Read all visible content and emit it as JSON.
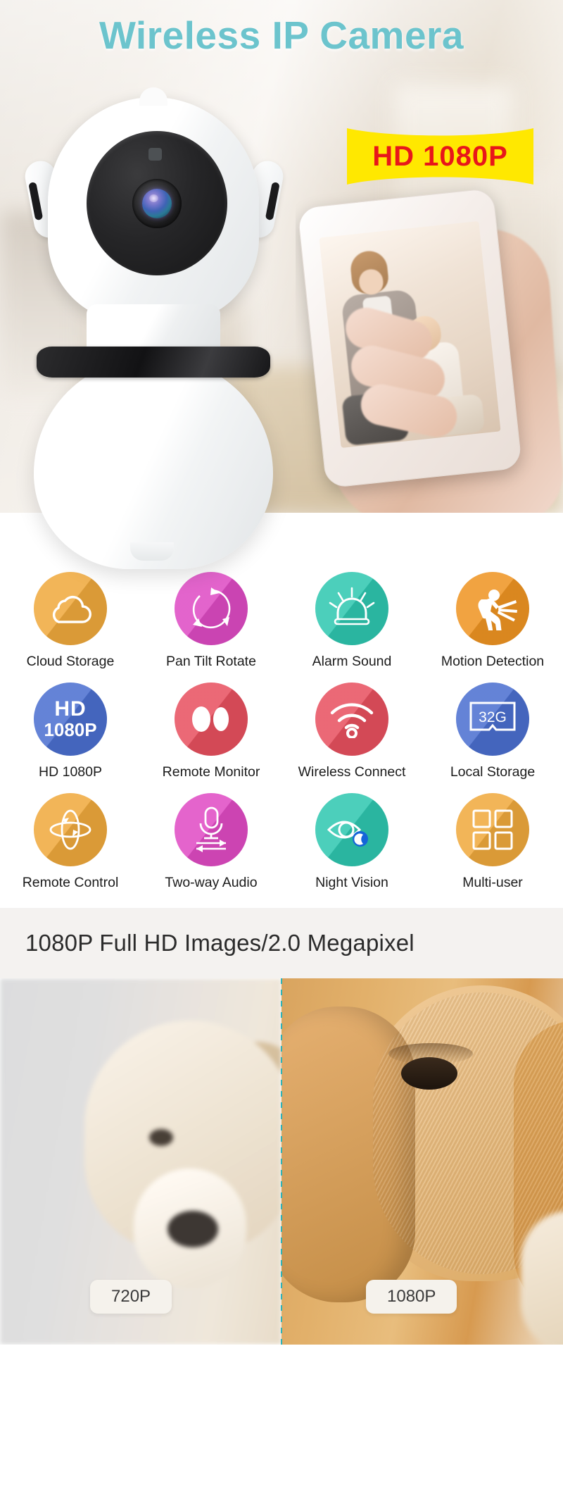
{
  "hero": {
    "title": "Wireless IP Camera",
    "badge": "HD 1080P",
    "product_alt": "white-pan-tilt-wifi-ip-camera",
    "phone_alt": "hand-holding-smartphone-showing-man-and-baby-live-view"
  },
  "features": {
    "rows": [
      [
        {
          "label": "Cloud Storage",
          "icon": "cloud-icon",
          "color": "#f0a93c"
        },
        {
          "label": "Pan Tilt Rotate",
          "icon": "rotate-arrows-icon",
          "color": "#de4bc4"
        },
        {
          "label": "Alarm Sound",
          "icon": "siren-icon",
          "color": "#2ec7b0"
        },
        {
          "label": "Motion Detection",
          "icon": "intruder-beam-icon",
          "color": "#ef9422"
        }
      ],
      [
        {
          "label": "HD 1080P",
          "icon": "hd-1080p-text-icon",
          "color": "#4b6fd0",
          "text_line1": "HD",
          "text_line2": "1080P"
        },
        {
          "label": "Remote Monitor",
          "icon": "two-eyes-icon",
          "color": "#e8505f"
        },
        {
          "label": "Wireless Connect",
          "icon": "wifi-icon",
          "color": "#e8505f"
        },
        {
          "label": "Local Storage",
          "icon": "sd-card-icon",
          "color": "#4b6fd0",
          "card_text": "32G"
        }
      ],
      [
        {
          "label": "Remote Control",
          "icon": "rotation-axes-icon",
          "color": "#f0a93c"
        },
        {
          "label": "Two-way Audio",
          "icon": "microphone-arrows-icon",
          "color": "#e04bc4"
        },
        {
          "label": "Night Vision",
          "icon": "eye-moon-icon",
          "color": "#2ec7b0"
        },
        {
          "label": "Multi-user",
          "icon": "four-squares-icon",
          "color": "#f0a93c"
        }
      ]
    ]
  },
  "banner": {
    "text": "1080P Full HD  Images/2.0 Megapixel"
  },
  "compare": {
    "left_label": "720P",
    "right_label": "1080P",
    "image_alt": "golden-retriever-dog-quality-comparison",
    "divider_color": "#2fb3b8"
  }
}
